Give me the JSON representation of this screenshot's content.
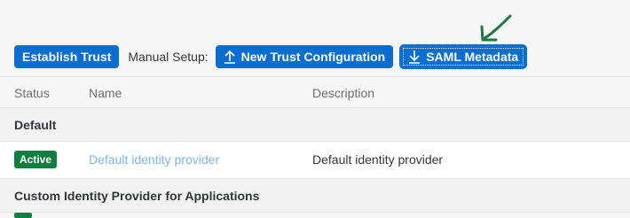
{
  "toolbar": {
    "establish_trust_label": "Establish Trust",
    "manual_setup_label": "Manual Setup:",
    "new_trust_label": "New Trust Configuration",
    "saml_metadata_label": "SAML Metadata",
    "upload_icon": "upload-icon",
    "download_icon": "download-icon"
  },
  "table": {
    "columns": [
      "Status",
      "Name",
      "Description"
    ],
    "groups": [
      {
        "title": "Default",
        "rows": [
          {
            "status": "Active",
            "name": "Default identity provider",
            "description": "Default identity provider"
          }
        ]
      },
      {
        "title": "Custom Identity Provider for Applications",
        "rows": []
      }
    ]
  },
  "colors": {
    "accent": "#0a6ed1",
    "active_badge": "#107e3e",
    "link": "#7fb3e6",
    "annotation_arrow": "#1b7a45"
  }
}
